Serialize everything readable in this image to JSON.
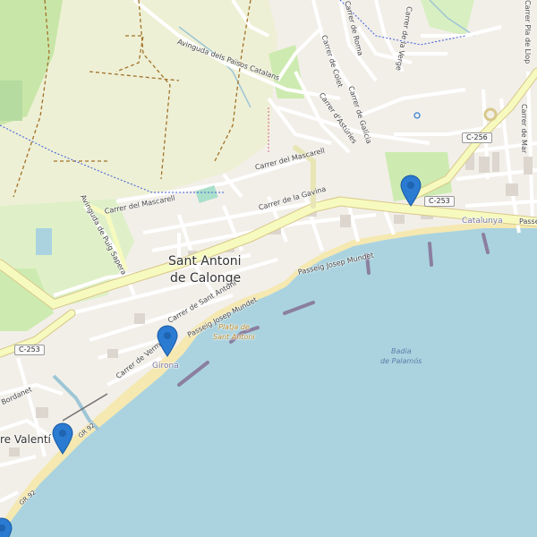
{
  "map": {
    "city_label": [
      "Sant Antoni",
      "de Calonge"
    ],
    "town_partial": "re Valentí",
    "bay_label": [
      "Badia",
      "de Palamós"
    ],
    "beach_label": [
      "Platja de",
      "Sant Antoni"
    ],
    "region_labels": {
      "girona": "Girona",
      "catalunya": "Catalunya"
    },
    "road_shields": {
      "c253_left": "C-253",
      "c253_right": "C-253",
      "c256": "C-256",
      "gr92_a": "GR 92",
      "gr92_b": "GR 92"
    },
    "streets": {
      "avinguda_paisos": "Avinguda dels Països Catalans",
      "carrer_mascarell_top": "Carrer del Mascarell",
      "carrer_mascarell_left": "Carrer del Mascarell",
      "carrer_gavina": "Carrer de la Gavina",
      "avinguda_puig": "Avinguda de Puig Sapera",
      "carrer_sant_antoni": "Carrer de Sant Antoni",
      "carrer_vermell": "Carrer de Vermell",
      "passeig_mundet_1": "Passeig Josep Mundet",
      "passeig_mundet_2": "Passeig Josep Mundet",
      "carrer_colet": "Carrer de Colet",
      "carrer_roma": "Carrer de Roma",
      "carrer_galicia": "Carrer de Galícia",
      "carrer_asturies": "Carrer d'Astúries",
      "carrer_verge": "Carrer de la Verge",
      "carrer_pla_llop": "Carrer Pla de Llop",
      "carrer_mar": "Carrer de Mar",
      "passeig_right": "Passeig",
      "bordanet": "Bordanet"
    },
    "markers": [
      "location-marker-1",
      "location-marker-2",
      "location-marker-3",
      "location-marker-4"
    ],
    "colors": {
      "sea": "#aad3df",
      "land": "#f2efe9",
      "beach": "#f5e8b0",
      "park": "#c8facc",
      "field": "#eef0d5",
      "primary_road": "#fcd6a4",
      "secondary_road": "#f7fabf",
      "marker": "#2a7bd1"
    }
  }
}
